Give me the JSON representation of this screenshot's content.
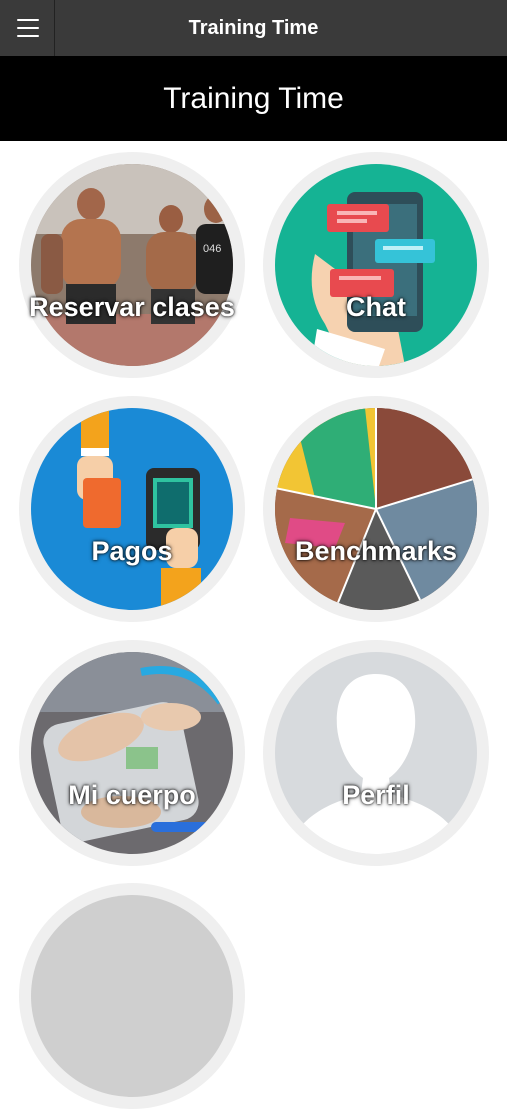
{
  "header": {
    "title": "Training Time",
    "menu_icon": "hamburger-menu-icon"
  },
  "banner": {
    "title": "Training Time"
  },
  "tiles": [
    {
      "label": "Reservar clases",
      "icon": "athletes-photo"
    },
    {
      "label": "Chat",
      "icon": "chat-phone-icon"
    },
    {
      "label": "Pagos",
      "icon": "card-payment-icon"
    },
    {
      "label": "Benchmarks",
      "icon": "sports-collage-photo"
    },
    {
      "label": "Mi cuerpo",
      "icon": "body-scale-photo"
    },
    {
      "label": "Perfil",
      "icon": "profile-silhouette-icon"
    },
    {
      "label": "",
      "icon": "partially-visible-tile"
    }
  ],
  "colors": {
    "topbar": "#3a3a3a",
    "banner": "#000000",
    "chat_bg": "#15b394",
    "payments_bg": "#1a8ad6",
    "profile_bg": "#d7dadd"
  }
}
